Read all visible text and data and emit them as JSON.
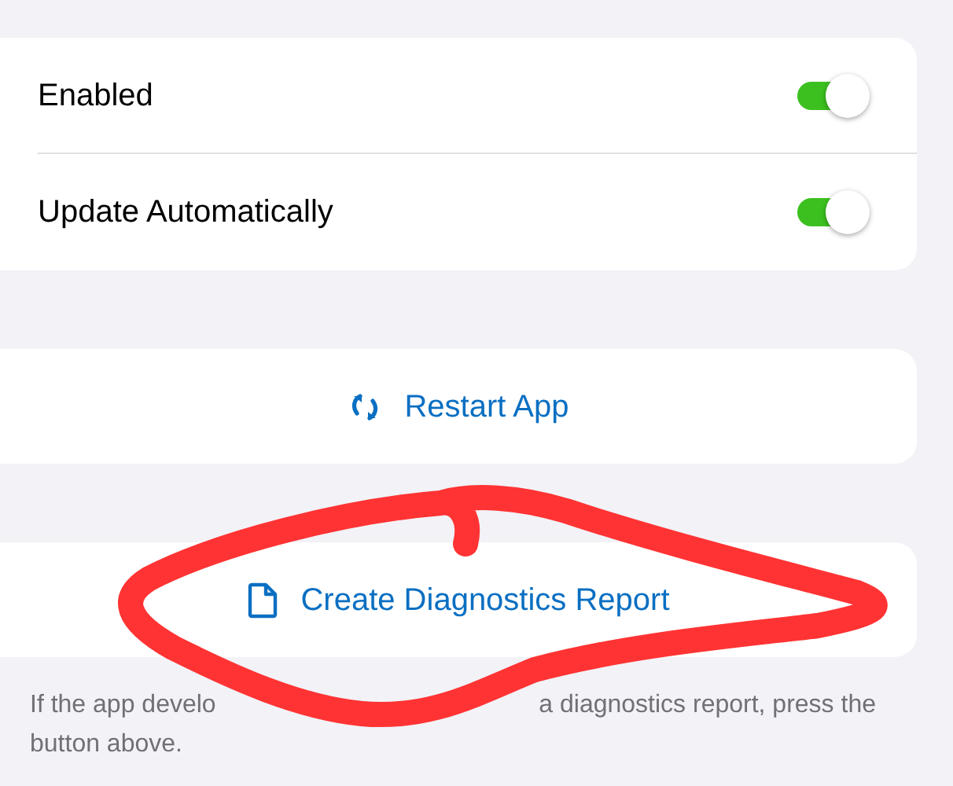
{
  "settings": [
    {
      "label": "Enabled",
      "on": true
    },
    {
      "label": "Update Automatically",
      "on": true
    }
  ],
  "actions": [
    {
      "kind": "restart",
      "label": "Restart App"
    },
    {
      "kind": "report",
      "label": "Create Diagnostics Report"
    }
  ],
  "footnote": [
    "If the app develo",
    "a diagnostics report, press the",
    "button above."
  ]
}
